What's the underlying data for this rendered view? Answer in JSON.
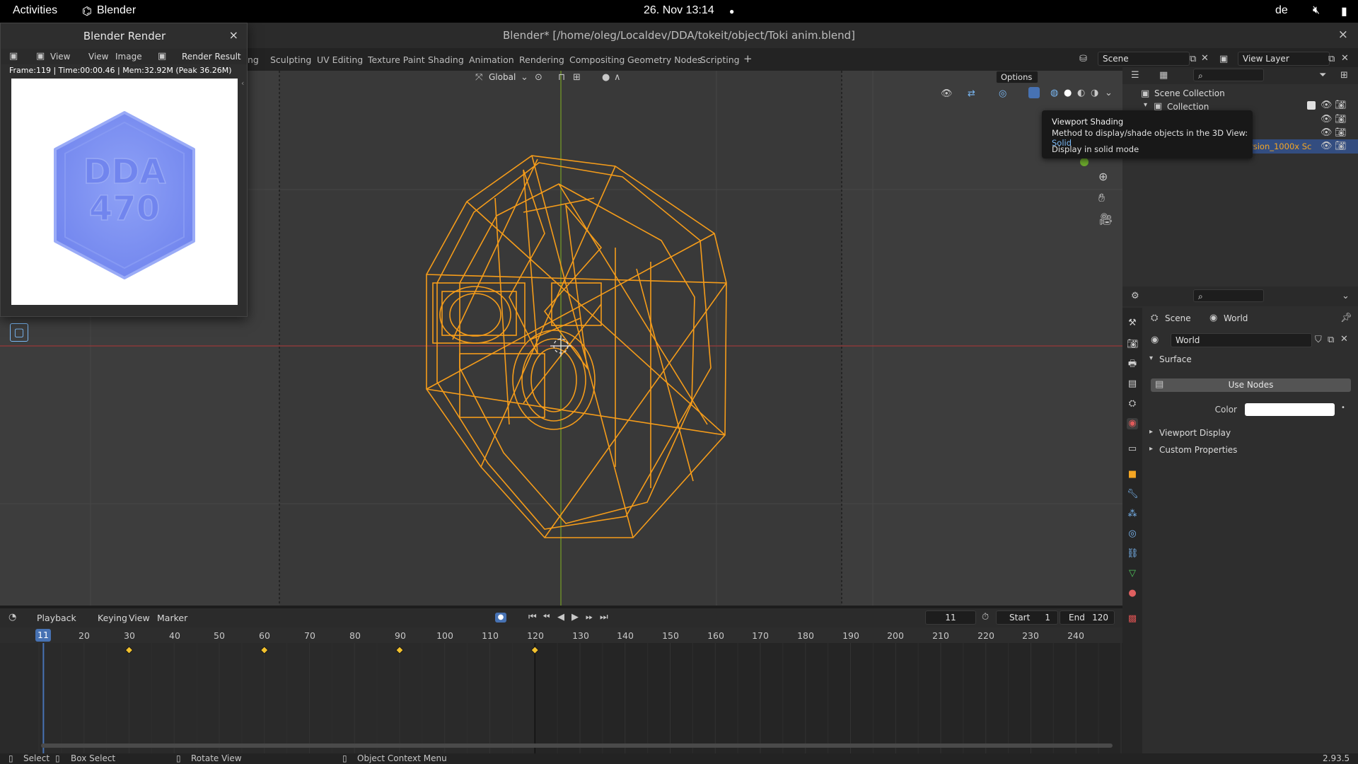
{
  "topbar": {
    "activities": "Activities",
    "app_name": "Blender",
    "datetime": "26. Nov  13:14",
    "keyboard_layout": "de"
  },
  "window": {
    "title": "Blender* [/home/oleg/Localdev/DDA/tokeit/object/Toki anim.blend]",
    "close": "×"
  },
  "workspace_tabs": [
    "ng",
    "Sculpting",
    "UV Editing",
    "Texture Paint",
    "Shading",
    "Animation",
    "Rendering",
    "Compositing",
    "Geometry Nodes",
    "Scripting",
    "+"
  ],
  "top_right": {
    "scene": "Scene",
    "view_layer": "View Layer"
  },
  "viewport": {
    "transform_orientation": "Global",
    "options": "Options"
  },
  "render_window": {
    "title": "Blender Render",
    "close": "×",
    "menus": [
      "View",
      "View",
      "Image"
    ],
    "slot": "Render Result",
    "info": "Frame:119 | Time:00:00.46 | Mem:32.92M (Peak 36.26M)",
    "coin_text_line1": "DDA",
    "coin_text_line2": "470"
  },
  "tooltip": {
    "title": "Viewport Shading",
    "description": "Method to display/shade objects in the 3D View:",
    "value": "Solid",
    "detail": "Display in solid mode"
  },
  "outliner": {
    "scene_collection": "Scene Collection",
    "collection": "Collection",
    "selected_object": "rsion_1000x Sc"
  },
  "properties": {
    "breadcrumb_scene": "Scene",
    "breadcrumb_world": "World",
    "world_name": "World",
    "surface": "Surface",
    "use_nodes": "Use Nodes",
    "color_label": "Color",
    "color_value": "#ffffff",
    "viewport_display": "Viewport Display",
    "custom_properties": "Custom Properties"
  },
  "timeline": {
    "menus": [
      "Playback",
      "Keying",
      "View",
      "Marker"
    ],
    "current_frame": "11",
    "start_label": "Start",
    "start_value": "1",
    "end_label": "End",
    "end_value": "120",
    "ruler_labels": [
      "20",
      "30",
      "40",
      "50",
      "60",
      "70",
      "80",
      "90",
      "100",
      "110",
      "120",
      "130",
      "140",
      "150",
      "160",
      "170",
      "180",
      "190",
      "200",
      "210",
      "220",
      "230",
      "240"
    ],
    "keyframes": [
      30,
      60,
      90,
      120
    ]
  },
  "statusbar": {
    "select": "Select",
    "box_select": "Box Select",
    "rotate_view": "Rotate View",
    "context_menu": "Object Context Menu",
    "version": "2.93.5"
  },
  "colors": {
    "accent_blue": "#4772b3",
    "wire_orange": "#f59c1a",
    "keyframe": "#f2c12e",
    "coin_blue": "#7e93f2"
  }
}
